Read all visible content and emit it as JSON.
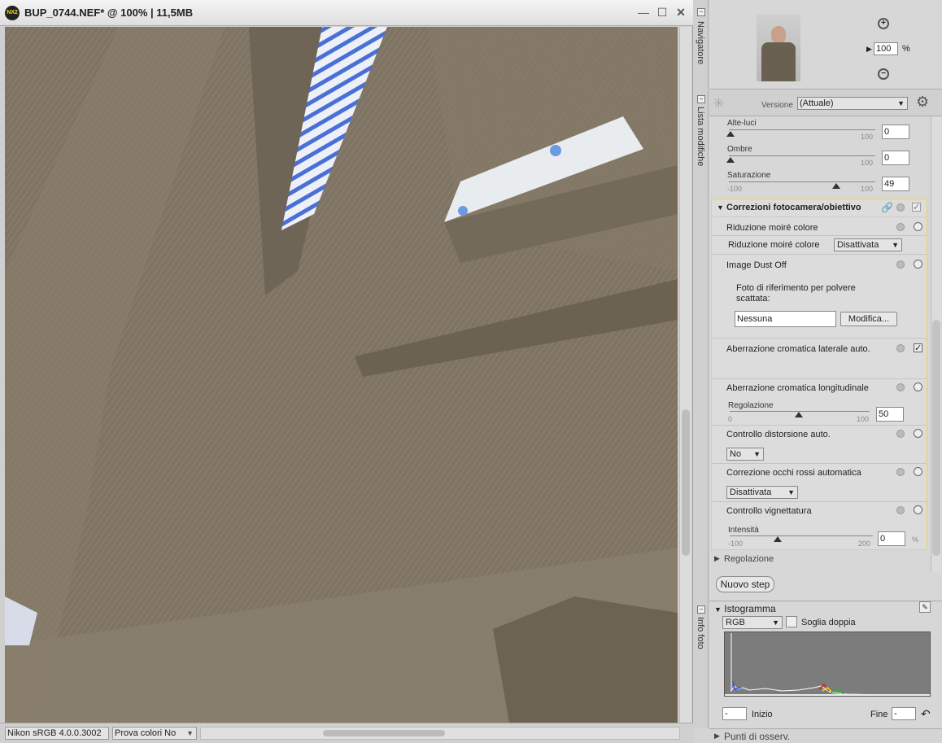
{
  "window": {
    "title": "BUP_0744.NEF* @ 100% | 11,5MB",
    "logo": "NX2"
  },
  "window_controls": {
    "minimize": "—",
    "maximize": "☐",
    "close": "✕"
  },
  "statusbar": {
    "profile": "Nikon sRGB 4.0.0.3002",
    "proof": "Prova colori No"
  },
  "tabs": {
    "navigator": "Navigatore",
    "edit_list": "Lista modifiche",
    "photo_info": "Info foto"
  },
  "navigator": {
    "zoom": "100",
    "zoom_unit": "%"
  },
  "edit": {
    "version_label": "Versione",
    "version_value": "(Attuale)",
    "sliders": [
      {
        "label": "Alte-luci",
        "value": "0",
        "max": "100"
      },
      {
        "label": "Ombre",
        "value": "0",
        "max": "100"
      },
      {
        "label": "Saturazione",
        "value": "49",
        "min": "-100",
        "max": "100"
      }
    ],
    "group_title": "Correzioni fotocamera/obiettivo",
    "moire": {
      "title": "Riduzione moiré colore",
      "label": "Riduzione moiré colore",
      "value": "Disattivata"
    },
    "dust": {
      "title": "Image Dust Off",
      "text": "Foto di riferimento per polvere scattata:",
      "value": "Nessuna",
      "button": "Modifica..."
    },
    "lateral": {
      "title": "Aberrazione cromatica laterale auto.",
      "check": "✓"
    },
    "longitudinal": {
      "title": "Aberrazione cromatica longitudinale",
      "label": "Regolazione",
      "min": "0",
      "max": "100",
      "value": "50"
    },
    "distortion": {
      "title": "Controllo distorsione auto.",
      "value": "No"
    },
    "redeye": {
      "title": "Correzione occhi rossi automatica",
      "value": "Disattivata"
    },
    "vignette": {
      "title": "Controllo vignettatura",
      "label": "Intensità",
      "min": "-100",
      "max": "200",
      "value": "0",
      "unit": "%"
    },
    "regolazione": "Regolazione",
    "new_step": "Nuovo step"
  },
  "info": {
    "title": "Istogramma",
    "channel": "RGB",
    "double_threshold": "Soglia doppia",
    "start_label": "Inizio",
    "start_value": "-",
    "end_label": "Fine",
    "end_value": "-",
    "points": "Punti di osserv."
  },
  "colors": {
    "accent_group": "#e8d36a",
    "fabric": "#7d7262",
    "shirt_stripe": "#4a6fd6"
  }
}
